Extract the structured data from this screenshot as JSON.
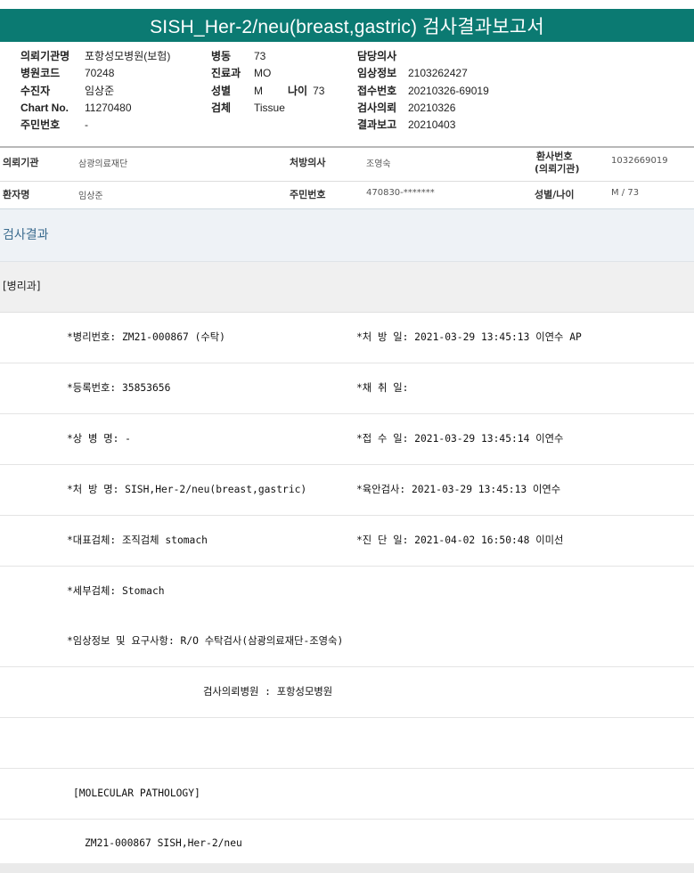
{
  "title": "SISH_Her-2/neu(breast,gastric) 검사결과보고서",
  "header": {
    "col1": [
      {
        "label": "의뢰기관명",
        "value": "포항성모병원(보험)"
      },
      {
        "label": "병원코드",
        "value": "70248"
      },
      {
        "label": "수진자",
        "value": "임상준"
      },
      {
        "label": "Chart No.",
        "value": "11270480"
      },
      {
        "label": "주민번호",
        "value": "-"
      }
    ],
    "col2": [
      {
        "label": "병동",
        "value": "73"
      },
      {
        "label": "진료과",
        "value": "MO"
      },
      {
        "label": "성별",
        "value": "M",
        "label2": "나이",
        "value2": "73"
      },
      {
        "label": "검체",
        "value": "Tissue"
      }
    ],
    "col3": [
      {
        "label": "담당의사",
        "value": ""
      },
      {
        "label": "임상정보",
        "value": "2103262427"
      },
      {
        "label": "접수번호",
        "value": "20210326-69019"
      },
      {
        "label": "검사의뢰",
        "value": "20210326"
      },
      {
        "label": "결과보고",
        "value": "20210403"
      }
    ]
  },
  "info": {
    "row1": {
      "org_label": "의뢰기관",
      "org_value": "삼광의료재단",
      "doctor_label": "처방의사",
      "doctor_value": "조영숙",
      "patno_label_1": "환사번호",
      "patno_label_2": "(의뢰기관)",
      "patno_value": "1032669019"
    },
    "row2": {
      "name_label": "환자명",
      "name_value": "임상준",
      "rrn_label": "주민번호",
      "rrn_value": "470830-*******",
      "sexage_label": "성별/나이",
      "sexage_value": "M / 73"
    }
  },
  "result_section": "검사결과",
  "dept": "[병리과]",
  "rows": [
    {
      "left": "*병리번호: ZM21-000867 (수탁)",
      "right": "*처 방 일: 2021-03-29 13:45:13  이연수 AP"
    },
    {
      "left": "*등록번호: 35853656",
      "right": "*채 취 일:"
    },
    {
      "left": "*상 병 명: -",
      "right": "*접 수 일: 2021-03-29 13:45:14  이연수"
    },
    {
      "left": "*처 방 명: SISH,Her-2/neu(breast,gastric)",
      "right": "*육안검사: 2021-03-29 13:45:13  이연수"
    },
    {
      "left": "*대표검체: 조직검체 stomach",
      "right": "*진 단 일: 2021-04-02 16:50:48  이미선"
    },
    {
      "left": "*세부검체: Stomach",
      "right": ""
    },
    {
      "left": "*임상정보 및 요구사항: R/O 수탁검사(삼광의료재단-조영숙)",
      "right": ""
    }
  ],
  "referral": "검사의뢰병원   : 포항성모병원",
  "molecular": "[MOLECULAR PATHOLOGY]",
  "mol_line": "ZM21-000867     SISH,Her-2/neu"
}
